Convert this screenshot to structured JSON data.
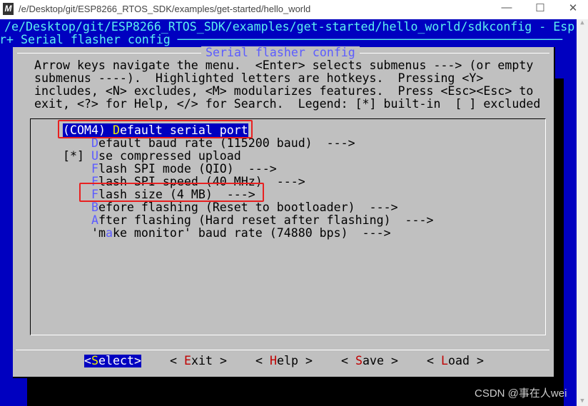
{
  "window": {
    "title": "/e/Desktop/git/ESP8266_RTOS_SDK/examples/get-started/hello_world",
    "logo": "M",
    "minimize": "—",
    "maximize": "☐",
    "close": "✕"
  },
  "terminal": {
    "line1": "/e/Desktop/git/ESP8266_RTOS_SDK/examples/get-started/hello_world/sdkconfig - Esp",
    "line2": "r+ Serial flasher config ──────────────────────────────────────────────────────"
  },
  "dialog": {
    "title": "Serial flasher config",
    "help": [
      "Arrow keys navigate the menu.  <Enter> selects submenus ---> (or empty",
      "submenus ----).  Highlighted letters are hotkeys.  Pressing <Y>",
      "includes, <N> excludes, <M> modularizes features.  Press <Esc><Esc> to",
      "exit, <?> for Help, </> for Search.  Legend: [*] built-in  [ ] excluded"
    ],
    "items": [
      {
        "prefix": "(COM4) ",
        "hotkey": "D",
        "rest": "efault serial port",
        "selected": true
      },
      {
        "prefix": "    ",
        "hotkey": "D",
        "rest": "efault baud rate (115200 baud)  --->"
      },
      {
        "prefix": "[*] ",
        "hotkey": "U",
        "rest": "se compressed upload"
      },
      {
        "prefix": "    ",
        "hotkey": "F",
        "rest": "lash SPI mode (QIO)  --->"
      },
      {
        "prefix": "    ",
        "hotkey": "F",
        "rest": "lash SPI speed (40 MHz)  --->"
      },
      {
        "prefix": "    ",
        "hotkey": "F",
        "rest": "lash size (4 MB)  --->"
      },
      {
        "prefix": "    ",
        "hotkey": "B",
        "rest": "efore flashing (Reset to bootloader)  --->"
      },
      {
        "prefix": "    ",
        "hotkey": "A",
        "rest": "fter flashing (Hard reset after flashing)  --->"
      },
      {
        "prefix": "    'm",
        "hotkey": "a",
        "rest": "ke monitor' baud rate (74880 bps)  --->"
      }
    ],
    "buttons": [
      {
        "pre": "<",
        "hotkey": "S",
        "rest": "elect>",
        "active": true
      },
      {
        "pre": "< ",
        "hotkey": "E",
        "rest": "xit >"
      },
      {
        "pre": "< ",
        "hotkey": "H",
        "rest": "elp >"
      },
      {
        "pre": "< ",
        "hotkey": "S",
        "rest": "ave >"
      },
      {
        "pre": "< ",
        "hotkey": "L",
        "rest": "oad >"
      }
    ]
  },
  "watermark": "CSDN @事在人wei",
  "colors": {
    "terminal_bg": "#0000c0",
    "dialog_bg": "#c0c0c0",
    "hotkey": "#5c5cff",
    "button_hotkey": "#c00000",
    "annotation": "#e82020"
  }
}
